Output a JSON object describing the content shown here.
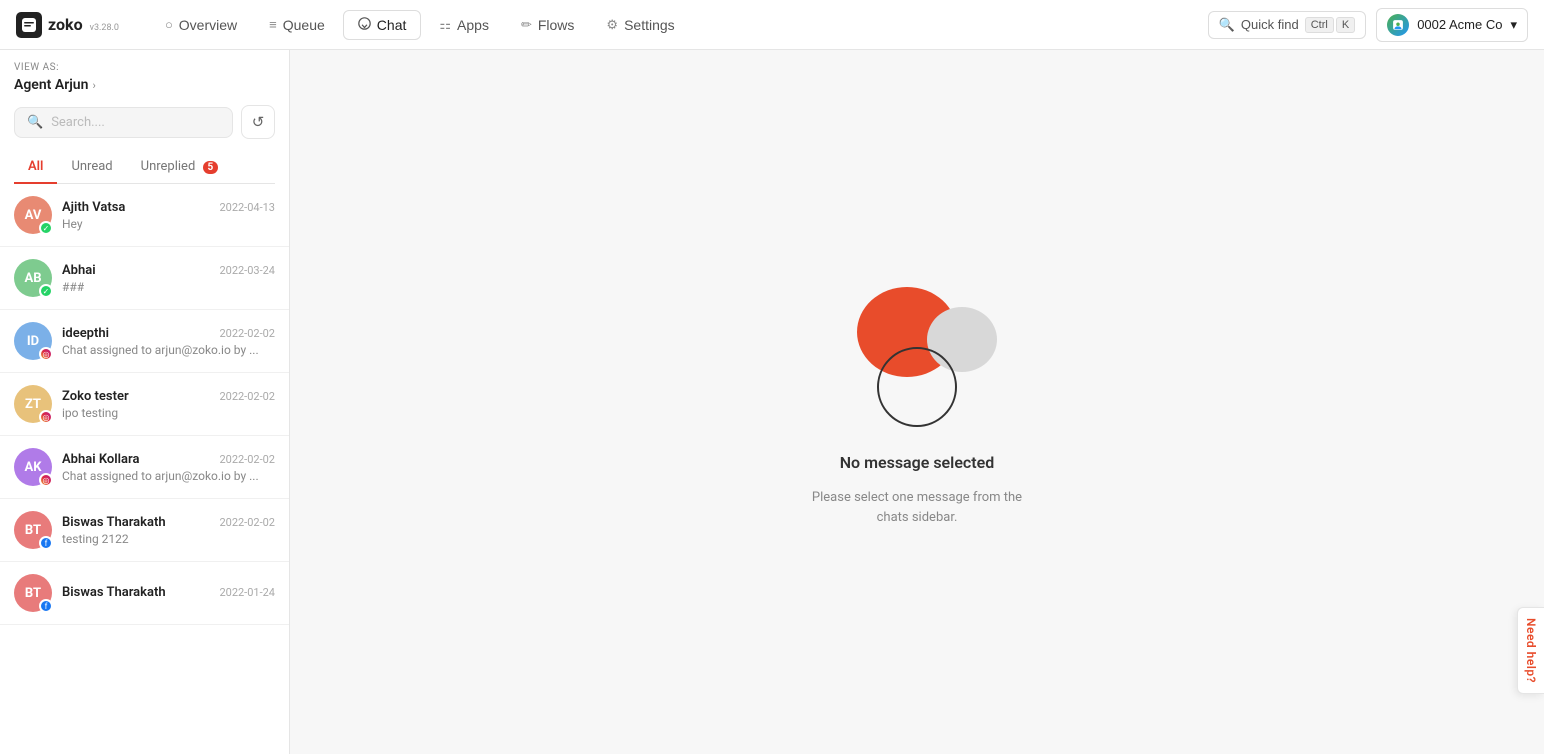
{
  "app": {
    "logo_text": "zoko",
    "logo_version": "v3.28.0"
  },
  "nav": {
    "items": [
      {
        "id": "overview",
        "label": "Overview",
        "icon": "○",
        "active": false
      },
      {
        "id": "queue",
        "label": "Queue",
        "icon": "≡",
        "active": false
      },
      {
        "id": "chat",
        "label": "Chat",
        "icon": "💬",
        "active": true
      },
      {
        "id": "apps",
        "label": "Apps",
        "icon": "⚏",
        "active": false
      },
      {
        "id": "flows",
        "label": "Flows",
        "icon": "✏",
        "active": false
      },
      {
        "id": "settings",
        "label": "Settings",
        "icon": "⚙",
        "active": false
      }
    ],
    "quick_find_label": "Quick find",
    "ctrl_label": "Ctrl",
    "k_label": "K",
    "workspace_name": "0002 Acme Co"
  },
  "sidebar": {
    "view_as_label": "VIEW AS:",
    "agent_name": "Agent Arjun",
    "search_placeholder": "Search....",
    "tabs": [
      {
        "id": "all",
        "label": "All",
        "badge": null,
        "active": true
      },
      {
        "id": "unread",
        "label": "Unread",
        "badge": null,
        "active": false
      },
      {
        "id": "unreplied",
        "label": "Unreplied",
        "badge": "5",
        "active": false
      }
    ],
    "chats": [
      {
        "id": "ajith-vatsa",
        "name": "Ajith Vatsa",
        "date": "2022-04-13",
        "preview": "Hey",
        "initials": "AV",
        "avatar_color": "#e88a73",
        "channel": "whatsapp"
      },
      {
        "id": "abhai",
        "name": "Abhai",
        "date": "2022-03-24",
        "preview": "###",
        "initials": "AB",
        "avatar_color": "#7ecb8f",
        "channel": "whatsapp"
      },
      {
        "id": "ideepthi",
        "name": "ideepthi",
        "date": "2022-02-02",
        "preview": "Chat assigned to arjun@zoko.io by ...",
        "initials": "ID",
        "avatar_color": "#7bb0e8",
        "channel": "instagram"
      },
      {
        "id": "zoko-tester",
        "name": "Zoko tester",
        "date": "2022-02-02",
        "preview": "ipo testing",
        "initials": "ZT",
        "avatar_color": "#e8c27b",
        "channel": "instagram"
      },
      {
        "id": "abhai-kollara",
        "name": "Abhai Kollara",
        "date": "2022-02-02",
        "preview": "Chat assigned to arjun@zoko.io by ...",
        "initials": "AK",
        "avatar_color": "#b07be8",
        "channel": "instagram"
      },
      {
        "id": "biswas-tharakath-1",
        "name": "Biswas Tharakath",
        "date": "2022-02-02",
        "preview": "testing 2122",
        "initials": "BT",
        "avatar_color": "#e87b7b",
        "channel": "facebook"
      },
      {
        "id": "biswas-tharakath-2",
        "name": "Biswas Tharakath",
        "date": "2022-01-24",
        "preview": "",
        "initials": "BT",
        "avatar_color": "#e87b7b",
        "channel": "facebook"
      }
    ]
  },
  "main": {
    "empty_title": "No message selected",
    "empty_subtitle": "Please select one message from the\nchats sidebar."
  },
  "help": {
    "label": "Need help?"
  }
}
